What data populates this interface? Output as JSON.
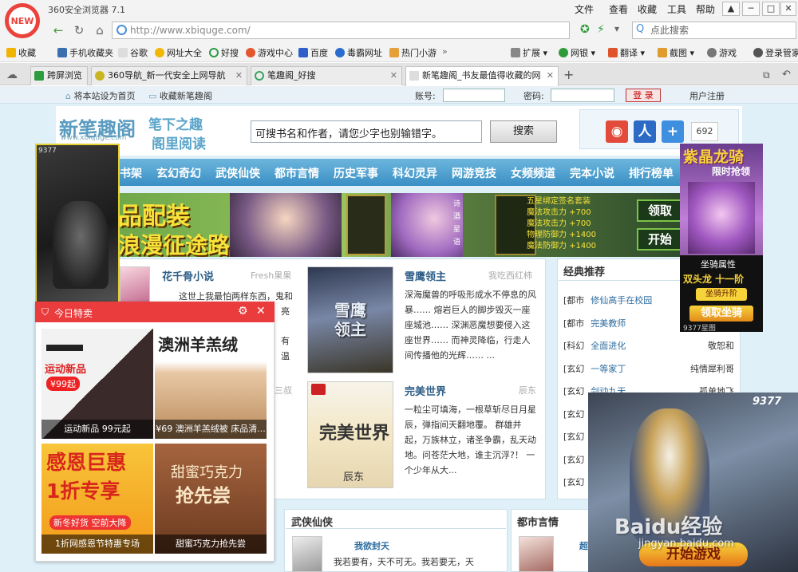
{
  "browser": {
    "logo_text": "NEW",
    "title": "360安全浏览器 7.1",
    "menus": [
      "文件",
      "查看",
      "收藏",
      "工具",
      "帮助"
    ],
    "url": "http://www.xbiquge.com/",
    "search_placeholder": "点此搜索",
    "bookmarks": [
      "收藏",
      "手机收藏夹",
      "谷歌",
      "网址大全",
      "好搜",
      "游戏中心",
      "百度",
      "毒霸网址",
      "热门小游"
    ],
    "tools": [
      "扩展",
      "网银",
      "翻译",
      "截图",
      "游戏",
      "登录管家"
    ],
    "tabs": [
      {
        "label": "跨屏浏览",
        "color": "#2e9c3e"
      },
      {
        "label": "360导航_新一代安全上网导航",
        "color": "#c9b521"
      },
      {
        "label": "笔趣阁_好搜",
        "color": "#3aa35e"
      },
      {
        "label": "新笔趣阁_书友最值得收藏的网",
        "color": "#888888"
      }
    ],
    "new_tab": "+"
  },
  "site": {
    "topbar": {
      "set_home": "将本站设为首页",
      "bookmark": "收藏新笔趣阁",
      "account_label": "账号:",
      "password_label": "密码:",
      "login_button": "登 录",
      "register": "用户注册"
    },
    "logo_text": "新笔趣阁",
    "logo_domain": "www.xbiquge.com",
    "slogan_line1": "笔下之趣",
    "slogan_line2": "阁里阅读",
    "search_value": "可搜书名和作者，请您少字也别输错字。",
    "search_button": "搜索",
    "share_count": "692",
    "nav": [
      "书架",
      "玄幻奇幻",
      "武侠仙侠",
      "都市言情",
      "历史军事",
      "科幻灵异",
      "网游竞技",
      "女频频道",
      "完本小说",
      "排行榜单"
    ],
    "banner": {
      "left_text1": "品配装",
      "left_text2": "浪漫征途路",
      "poem": [
        "诗",
        "酒",
        "星",
        "语"
      ],
      "stats_title": "五星绑定签名套装",
      "stats": [
        "魔法攻击力  +700",
        "魔法攻击力  +700",
        "物理防御力  +1400",
        "魔法防御力  +1400"
      ],
      "buttons": [
        "领取",
        "开始"
      ]
    },
    "featured": [
      {
        "title": "花千骨小说",
        "author": "Fresh果果",
        "desc": "这世上我最怕两样东西，鬼和",
        "more": [
          "亮",
          "有",
          "温"
        ]
      },
      {
        "title": "雪鹰领主",
        "author": "我吃西红柿",
        "cover": "雪鹰领主",
        "desc": "深海魔兽的呼吸形成水不停息的风暴…… 熔岩巨人的脚步毁灭一座座城池…… 深渊恶魔想要侵入这座世界…… 而神灵降临，行走人间传播他的光辉…… ..."
      },
      {
        "title": "完美世界",
        "author": "辰东",
        "cover": "完美世界",
        "cover_author": "辰东",
        "desc": "一粒尘可填海，一根草斩尽日月星辰，弹指间天翻地覆。 群雄并起，万族林立，诸圣争霸，乱天动地。问苍茫大地，谁主沉浮?！ 一个少年从大..."
      }
    ],
    "classic": {
      "heading": "经典推荐",
      "items": [
        {
          "cat": "[都市",
          "title": "修仙高手在校园",
          "author": ""
        },
        {
          "cat": "[都市",
          "title": "完美教师",
          "author": ""
        },
        {
          "cat": "[科幻",
          "title": "全面进化",
          "author": "敬恕和"
        },
        {
          "cat": "[玄幻",
          "title": "一等家丁",
          "author": "纯情犀利哥"
        },
        {
          "cat": "[玄幻",
          "title": "剑动九天",
          "author": "孤单地飞"
        },
        {
          "cat": "[玄幻",
          "title": "",
          "author": ""
        },
        {
          "cat": "[玄幻",
          "title": "",
          "author": ""
        },
        {
          "cat": "[玄幻",
          "title": "",
          "author": ""
        },
        {
          "cat": "[玄幻",
          "title": "",
          "author": ""
        }
      ]
    },
    "section_wuxia": {
      "heading": "武侠仙侠",
      "title": "我欲封天",
      "desc": "我若要有，天不可无。我若要无，天"
    },
    "section_urban": {
      "heading": "都市言情",
      "title": "超"
    },
    "partial_left": "三叔"
  },
  "ads": {
    "left_ad_label": "9377",
    "right_ad": {
      "title": "紫晶龙骑",
      "subtitle": "限时抢领",
      "caption": "坐骑属性",
      "promo": "双头龙 十一阶",
      "button1": "坐骑升阶",
      "button2": "领取坐骑",
      "site": "9377星图"
    },
    "popup": {
      "heading": "今日特卖",
      "cells": [
        {
          "label": "运动新品 99元起",
          "tag1": "运动新品",
          "tag2": "¥99起"
        },
        {
          "label": "¥69 澳洲羊羔绒被 床品清...",
          "tag1": "澳洲羊羔绒"
        },
        {
          "label": "1折网感恩节特惠专场",
          "tag1": "感恩巨惠",
          "tag2": "1折专享",
          "tag3": "新冬好货 空前大降"
        },
        {
          "label": "甜蜜巧克力抢先尝",
          "tag1": "甜蜜巧克力",
          "tag2": "抢先尝"
        }
      ]
    },
    "game_ad": {
      "label": "9377",
      "button": "开始游戏"
    },
    "watermark": {
      "brand": "Baidu经验",
      "url": "jingyan.baidu.com"
    }
  }
}
